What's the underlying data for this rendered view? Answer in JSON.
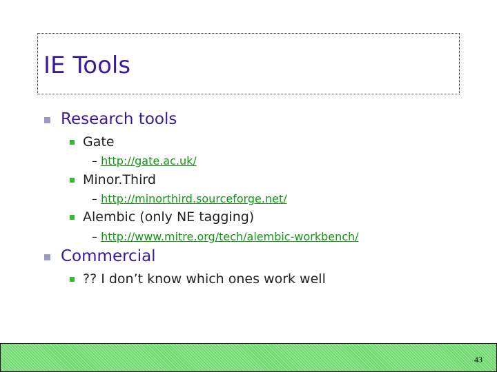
{
  "title": "IE Tools",
  "items": [
    {
      "label": "Research tools",
      "children": [
        {
          "label": "Gate",
          "link": "http://gate.ac.uk/"
        },
        {
          "label": "Minor.Third",
          "link": "http://minorthird.sourceforge.net/"
        },
        {
          "label": "Alembic (only NE tagging)",
          "link": "http://www.mitre.org/tech/alembic-workbench/"
        }
      ]
    },
    {
      "label": "Commercial",
      "children": [
        {
          "label": "?? I don’t know which ones work well"
        }
      ]
    }
  ],
  "page_number": "43"
}
